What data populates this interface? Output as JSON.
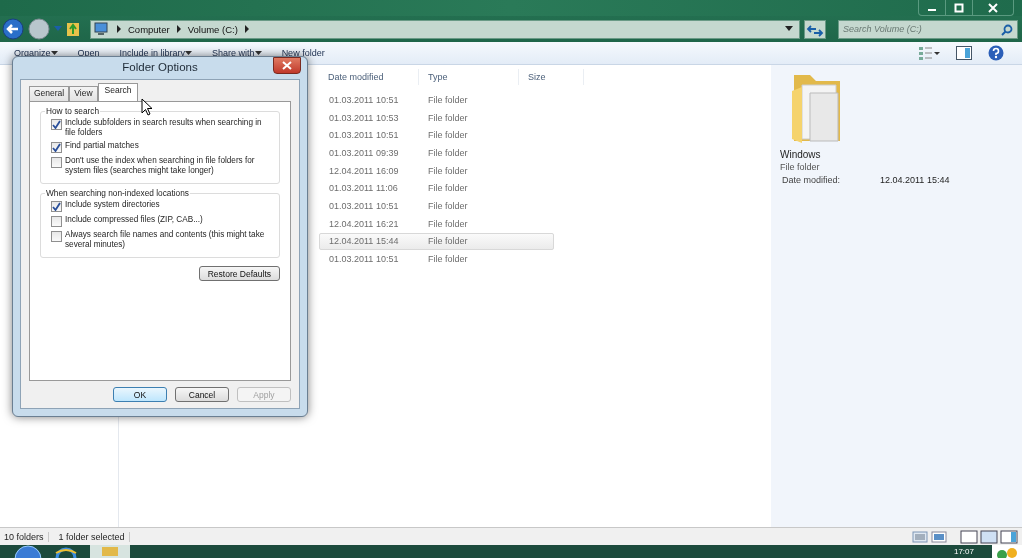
{
  "address_bar": {
    "breadcrumbs": [
      "Computer",
      "Volume (C:)"
    ]
  },
  "search": {
    "placeholder": "Search Volume (C:)"
  },
  "toolbar": {
    "items": [
      {
        "label": "Organize",
        "dropdown": true
      },
      {
        "label": "Open",
        "dropdown": false
      },
      {
        "label": "Include in library",
        "dropdown": true
      },
      {
        "label": "Share with",
        "dropdown": true
      },
      {
        "label": "New folder",
        "dropdown": false
      }
    ]
  },
  "file_list": {
    "columns": [
      "Date modified",
      "Type",
      "Size"
    ],
    "rows": [
      {
        "date": "01.03.2011 10:51",
        "type": "File folder",
        "selected": false
      },
      {
        "date": "01.03.2011 10:53",
        "type": "File folder",
        "selected": false
      },
      {
        "date": "01.03.2011 10:51",
        "type": "File folder",
        "selected": false
      },
      {
        "date": "01.03.2011 09:39",
        "type": "File folder",
        "selected": false
      },
      {
        "date": "12.04.2011 16:09",
        "type": "File folder",
        "selected": false
      },
      {
        "date": "01.03.2011 11:06",
        "type": "File folder",
        "selected": false
      },
      {
        "date": "01.03.2011 10:51",
        "type": "File folder",
        "selected": false
      },
      {
        "date": "12.04.2011 16:21",
        "type": "File folder",
        "selected": false
      },
      {
        "date": "12.04.2011 15:44",
        "type": "File folder",
        "selected": true
      },
      {
        "date": "01.03.2011 10:51",
        "type": "File folder",
        "selected": false
      }
    ]
  },
  "details_pane": {
    "name": "Windows",
    "type": "File folder",
    "label": "Date modified:",
    "value": "12.04.2011 15:44"
  },
  "status_bar": [
    "10 folders",
    "1 folder selected"
  ],
  "dialog": {
    "title": "Folder Options",
    "tabs": [
      {
        "label": "General",
        "selected": false
      },
      {
        "label": "View",
        "selected": false
      },
      {
        "label": "Search",
        "selected": true
      }
    ],
    "groups": [
      {
        "title": "How to search",
        "options": [
          {
            "label": "Include subfolders in search results when searching in file folders",
            "checked": true
          },
          {
            "label": "Find partial matches",
            "checked": true
          },
          {
            "label": "Don't use the index when searching in file folders for system files (searches might take longer)",
            "checked": false
          }
        ]
      },
      {
        "title": "When searching non-indexed locations",
        "options": [
          {
            "label": "Include system directories",
            "checked": true
          },
          {
            "label": "Include compressed files (ZIP, CAB...)",
            "checked": false
          },
          {
            "label": "Always search file names and contents (this might take several minutes)",
            "checked": false
          }
        ]
      }
    ],
    "restore_button": "Restore Defaults",
    "buttons": [
      {
        "label": "OK",
        "default": true,
        "disabled": false
      },
      {
        "label": "Cancel",
        "default": false,
        "disabled": false
      },
      {
        "label": "Apply",
        "default": false,
        "disabled": true
      }
    ]
  },
  "taskbar": {
    "clock": "17:07"
  }
}
